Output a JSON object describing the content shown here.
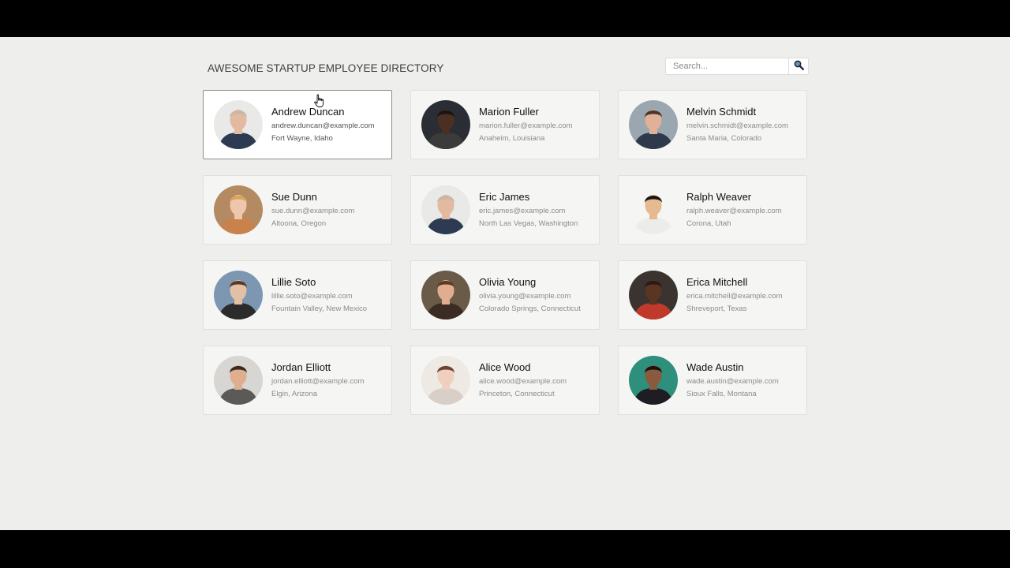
{
  "header": {
    "title": "AWESOME STARTUP EMPLOYEE DIRECTORY"
  },
  "search": {
    "placeholder": "Search...",
    "icon": "search-icon"
  },
  "employees": [
    {
      "name": "Andrew Duncan",
      "email": "andrew.duncan@example.com",
      "location": "Fort Wayne, Idaho",
      "skin": "#e3b9a0",
      "hair": "#c9b7a5",
      "shirt": "#2c3b52",
      "bg": "#e9e9e7",
      "active": true
    },
    {
      "name": "Marion Fuller",
      "email": "marion.fuller@example.com",
      "location": "Anaheim, Louisiana",
      "skin": "#4a2f22",
      "hair": "#1b1410",
      "shirt": "#3b3b3b",
      "bg": "#2a2d33",
      "active": false
    },
    {
      "name": "Melvin Schmidt",
      "email": "melvin.schmidt@example.com",
      "location": "Santa Maria, Colorado",
      "skin": "#e1b097",
      "hair": "#4a3628",
      "shirt": "#2e3a4c",
      "bg": "#9aa6b0",
      "active": false
    },
    {
      "name": "Sue Dunn",
      "email": "sue.dunn@example.com",
      "location": "Altoona, Oregon",
      "skin": "#efc6ab",
      "hair": "#d9a55a",
      "shirt": "#c9824c",
      "bg": "#b48a62",
      "active": false
    },
    {
      "name": "Eric James",
      "email": "eric.james@example.com",
      "location": "North Las Vegas, Washington",
      "skin": "#e3b9a0",
      "hair": "#c9b7a5",
      "shirt": "#2c3b52",
      "bg": "#e9e9e7",
      "active": false
    },
    {
      "name": "Ralph Weaver",
      "email": "ralph.weaver@example.com",
      "location": "Corona, Utah",
      "skin": "#e6b991",
      "hair": "#1a1612",
      "shirt": "#ececea",
      "bg": "#f5f5f3",
      "active": false
    },
    {
      "name": "Lillie Soto",
      "email": "lillie.soto@example.com",
      "location": "Fountain Valley, New Mexico",
      "skin": "#e2c0a6",
      "hair": "#5a3a24",
      "shirt": "#2b2b2b",
      "bg": "#7d97b3",
      "active": false
    },
    {
      "name": "Olivia Young",
      "email": "olivia.young@example.com",
      "location": "Colorado Springs, Connecticut",
      "skin": "#e0ae8e",
      "hair": "#5b3b23",
      "shirt": "#3c2b22",
      "bg": "#6a5a48",
      "active": false
    },
    {
      "name": "Erica Mitchell",
      "email": "erica.mitchell@example.com",
      "location": "Shreveport, Texas",
      "skin": "#5a3522",
      "hair": "#2a1a12",
      "shirt": "#c0392b",
      "bg": "#3b3330",
      "active": false
    },
    {
      "name": "Jordan Elliott",
      "email": "jordan.elliott@example.com",
      "location": "Elgin, Arizona",
      "skin": "#deae8f",
      "hair": "#3a2a20",
      "shirt": "#5b5a58",
      "bg": "#d8d6d2",
      "active": false
    },
    {
      "name": "Alice Wood",
      "email": "alice.wood@example.com",
      "location": "Princeton, Connecticut",
      "skin": "#f0cfbf",
      "hair": "#6b4331",
      "shirt": "#d8cfc8",
      "bg": "#efe9e4",
      "active": false
    },
    {
      "name": "Wade Austin",
      "email": "wade.austin@example.com",
      "location": "Sioux Falls, Montana",
      "skin": "#8a5a3e",
      "hair": "#1a1210",
      "shirt": "#1f1d24",
      "bg": "#2f8f7d",
      "active": false
    }
  ]
}
